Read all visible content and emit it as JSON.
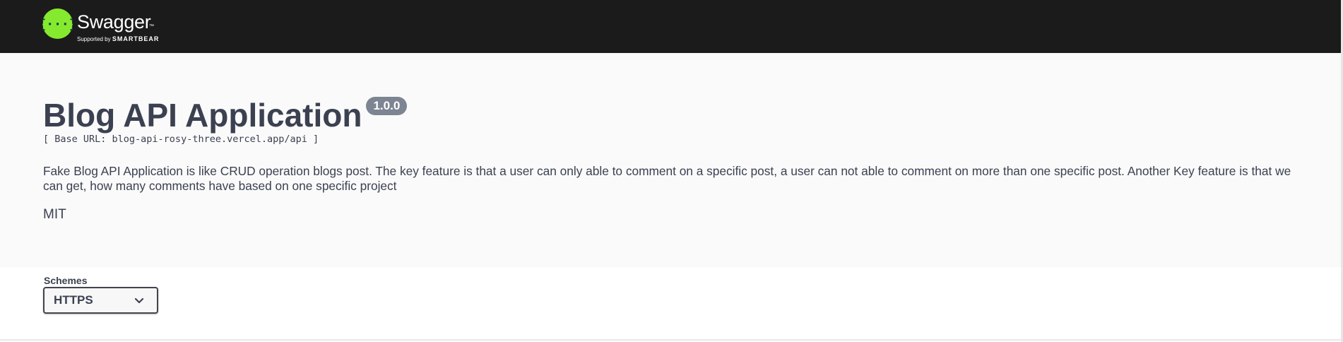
{
  "header": {
    "brand_name": "Swagger",
    "brand_tm": "™",
    "supported_by": "Supported by",
    "supporter": "SMARTBEAR",
    "logo_icon": "swagger-braces-icon",
    "colors": {
      "bar": "#1b1b1b",
      "logo": "#85ea2d"
    }
  },
  "info": {
    "title": "Blog API Application",
    "version": "1.0.0",
    "base_url": "[ Base URL: blog-api-rosy-three.vercel.app/api ]",
    "description": "Fake Blog API Application is like CRUD operation blogs post. The key feature is that a user can only able to comment on a specific post, a user can not able to comment on more than one specific post. Another Key feature is that we can get, how many comments have based on one specific project",
    "license": "MIT",
    "colors": {
      "background": "#fafafa",
      "text": "#3b4151",
      "version_badge": "#7d8492"
    }
  },
  "schemes": {
    "label": "Schemes",
    "selected": "HTTPS",
    "dropdown_icon": "chevron-down-icon"
  }
}
